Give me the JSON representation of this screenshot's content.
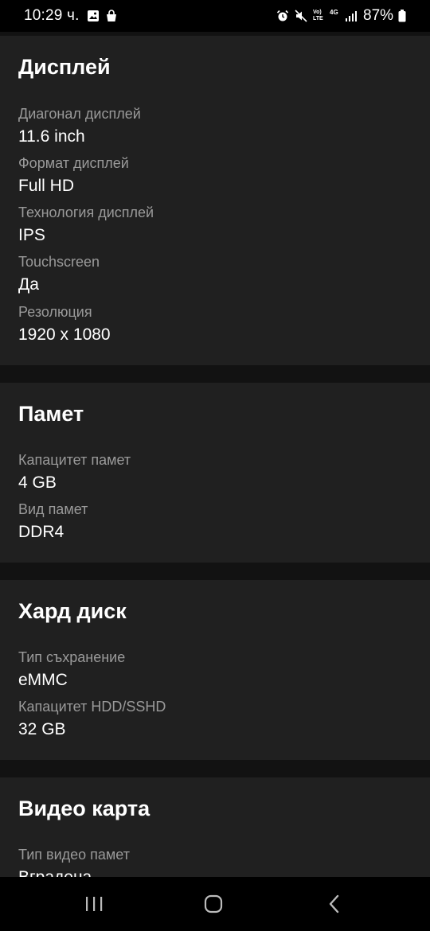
{
  "status_bar": {
    "time": "10:29 ч.",
    "battery": "87%",
    "icons": [
      "gallery-icon",
      "shopping-bag-icon",
      "alarm-icon",
      "mute-icon",
      "volte-icon",
      "4g-icon",
      "signal-icon",
      "battery-icon"
    ],
    "volte_label": "Vo) LTE",
    "network_label": "4G"
  },
  "sections": {
    "display": {
      "title": "Дисплей",
      "specs": [
        {
          "label": "Диагонал дисплей",
          "value": "11.6 inch"
        },
        {
          "label": "Формат дисплей",
          "value": "Full HD"
        },
        {
          "label": "Технология дисплей",
          "value": "IPS"
        },
        {
          "label": "Touchscreen",
          "value": "Да"
        },
        {
          "label": "Резолюция",
          "value": "1920 x 1080"
        }
      ]
    },
    "memory": {
      "title": "Памет",
      "specs": [
        {
          "label": "Капацитет памет",
          "value": "4 GB"
        },
        {
          "label": "Вид памет",
          "value": "DDR4"
        }
      ]
    },
    "storage": {
      "title": "Хард диск",
      "specs": [
        {
          "label": "Тип съхранение",
          "value": "eMMC"
        },
        {
          "label": "Капацитет HDD/SSHD",
          "value": "32 GB"
        }
      ]
    },
    "graphics": {
      "title": "Видео карта",
      "specs": [
        {
          "label": "Тип видео памет",
          "value": "Вградена"
        }
      ]
    }
  },
  "nav_bar": {
    "buttons": [
      "recents-icon",
      "home-icon",
      "back-icon"
    ]
  },
  "colors": {
    "background": "#121212",
    "card": "#202020",
    "label": "#9a9a9a",
    "value": "#ffffff"
  }
}
